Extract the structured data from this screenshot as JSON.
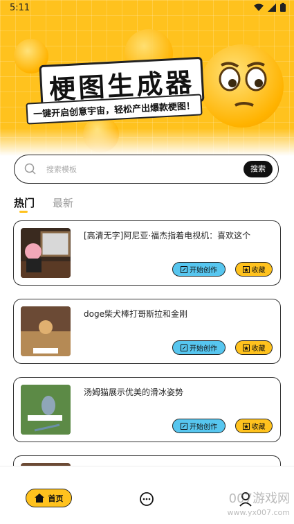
{
  "status": {
    "time": "5:11"
  },
  "banner": {
    "title": "梗图生成器",
    "subtitle": "一键开启创意宇宙，轻松产出爆款梗图！"
  },
  "search": {
    "placeholder": "搜索模板",
    "button": "搜索"
  },
  "tabs": [
    {
      "label": "热门",
      "active": true
    },
    {
      "label": "最新",
      "active": false
    }
  ],
  "cards": [
    {
      "title": "[高清无字]阿尼亚·福杰指着电视机：喜欢这个",
      "create": "开始创作",
      "favorite": "收藏"
    },
    {
      "title": "doge柴犬棒打哥斯拉和金刚",
      "create": "开始创作",
      "favorite": "收藏"
    },
    {
      "title": "汤姆猫展示优美的滑冰姿势",
      "create": "开始创作",
      "favorite": "收藏"
    }
  ],
  "tabbar": {
    "home": "首页"
  },
  "watermark": {
    "main": "007游戏网",
    "url": "www.yx007.com"
  },
  "colors": {
    "accent": "#ffc21e",
    "create_button": "#57c6ef"
  }
}
